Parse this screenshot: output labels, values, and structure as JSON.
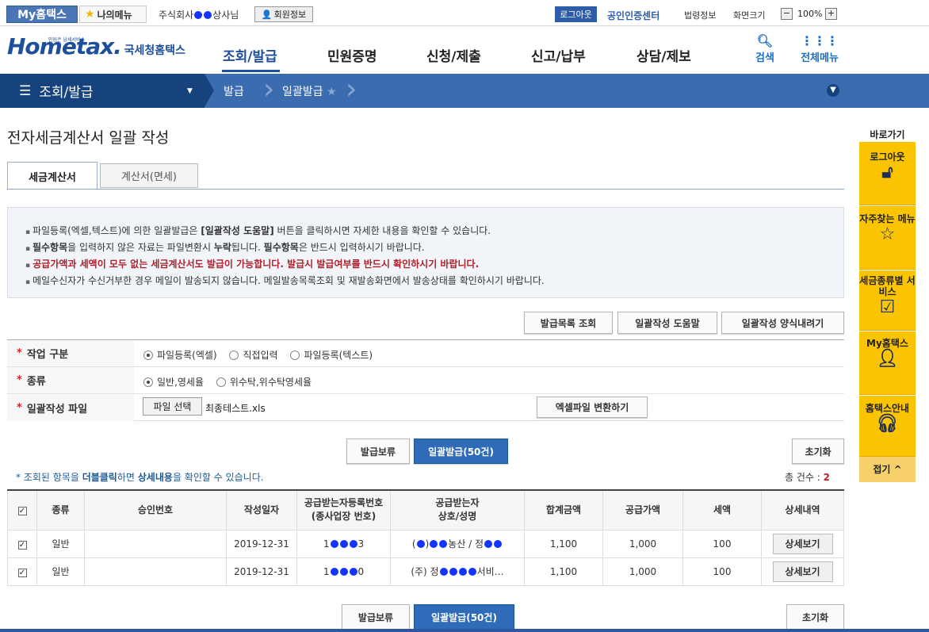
{
  "util": {
    "my_hometax": "My홈택스",
    "my_menu": "나의메뉴",
    "company_prefix": "주식회사",
    "company_suffix": "상사님",
    "member_info": "회원정보",
    "logout": "로그아웃",
    "cert_center": "공인인증센터",
    "law_info": "법령정보",
    "screen_size": "화면크기",
    "zoom": "100%",
    "zoom_minus": "−",
    "zoom_plus": "+"
  },
  "header": {
    "logo_text": "Hometax.",
    "logo_small": "민원은 납세서비스",
    "logo_sub": "국세청홈택스",
    "nav": [
      "조회/발급",
      "민원증명",
      "신청/제출",
      "신고/납부",
      "상담/제보"
    ],
    "search": "검색",
    "all_menu": "전체메뉴"
  },
  "breadcrumb": {
    "main": "조회/발급",
    "level2": "발급",
    "level3": "일괄발급"
  },
  "page": {
    "title": "전자세금계산서 일괄 작성",
    "tabs": [
      "세금계산서",
      "계산서(면세)"
    ]
  },
  "info": {
    "line1_a": "파일등록(엑셀,텍스트)에 의한 일괄발급은 ",
    "line1_b": "[일괄작성 도움말]",
    "line1_c": " 버튼을 클릭하시면 자세한 내용을 확인할 수 있습니다.",
    "line2_a": "필수항목",
    "line2_b": "을 입력하지 않은 자료는 파일변환시 ",
    "line2_c": "누락",
    "line2_d": "됩니다. ",
    "line2_e": "필수항목",
    "line2_f": "은 반드시 입력하시기 바랍니다.",
    "line3": "공급가액과 세액이 모두 없는 세금계산서도 발급이 가능합니다. 발급시 발급여부를 반드시 확인하시기 바랍니다.",
    "line4": "메일수신자가 수신거부한 경우 메일이 발송되지 않습니다. 메일발송목록조회 및 재발송화면에서 발송상태를 확인하시기 바랍니다."
  },
  "actions": {
    "list_view": "발급목록 조회",
    "help": "일괄작성 도움말",
    "download_form": "일괄작성 양식내려기"
  },
  "form": {
    "work_type_label": "작업 구분",
    "work_type_options": [
      "파일등록(엑셀)",
      "직접입력",
      "파일등록(텍스트)"
    ],
    "kind_label": "종류",
    "kind_options": [
      "일반,영세율",
      "위수탁,위수탁영세율"
    ],
    "file_label": "일괄작성 파일",
    "file_button": "파일 선택",
    "file_name": "최종테스트.xls",
    "convert_button": "엑셀파일 변환하기"
  },
  "mid": {
    "hold": "발급보류",
    "issue": "일괄발급(50건)",
    "reset": "초기화",
    "note_a": "* 조회된 항목을 ",
    "note_b": "더블클릭",
    "note_c": "하면 ",
    "note_d": "상세내용",
    "note_e": "을 확인할 수 있습니다.",
    "total_label": "총 건수 : ",
    "total_value": "2"
  },
  "table": {
    "headers": [
      "종류",
      "승인번호",
      "작성일자",
      "공급받는자등록번호",
      "(종사업장 번호)",
      "공급받는자",
      "상호/성명",
      "합계금액",
      "공급가액",
      "세액",
      "상세내역"
    ],
    "rows": [
      {
        "kind": "일반",
        "approval": "",
        "date": "2019-12-31",
        "reg_a": "1",
        "reg_b": "3",
        "name_a": "(",
        "name_b": "농산 / 정",
        "total": "1,100",
        "supply": "1,000",
        "tax": "100",
        "detail": "상세보기"
      },
      {
        "kind": "일반",
        "approval": "",
        "date": "2019-12-31",
        "reg_a": "1",
        "reg_b": "0",
        "name_a": "(주) 정",
        "name_b": "서비…",
        "total": "1,100",
        "supply": "1,000",
        "tax": "100",
        "detail": "상세보기"
      }
    ]
  },
  "bottom": {
    "hold": "발급보류",
    "issue": "일괄발급(50건)",
    "reset": "초기화"
  },
  "sidebar": {
    "title": "바로가기",
    "items": [
      "로그아웃",
      "자주찾는 메뉴",
      "세금종류별 서비스",
      "My홈택스",
      "홈택스안내"
    ],
    "footer": "접기 ^"
  },
  "colors": {
    "primary": "#1d4f9c",
    "crumb": "#3b6cb0",
    "sidebar": "#fbc400",
    "warn": "#b0202a"
  }
}
